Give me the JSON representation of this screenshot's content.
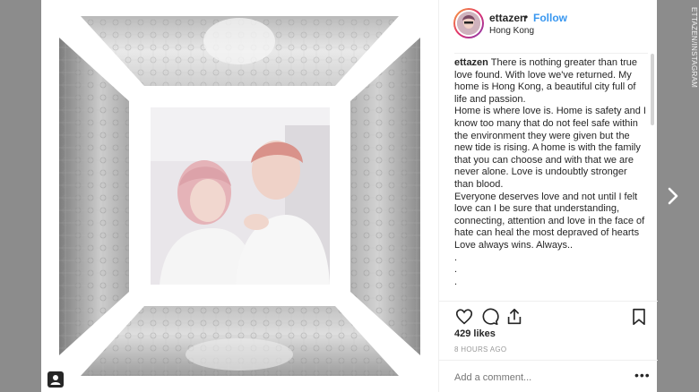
{
  "header": {
    "username": "ettazen",
    "separator": "•",
    "follow_label": "Follow",
    "location": "Hong Kong"
  },
  "caption": {
    "username": "ettazen",
    "lines": [
      "There is nothing greater than true love found. With love we've returned. My home is Hong Kong, a beautiful city full of life and passion.",
      "Home is where love is. Home is safety and I know too many that do not feel safe within the environment they were given but the new tide is rising. A home is with the family that you can choose and with that we are never alone. Love is undoubtly stronger than blood.",
      "Everyone deserves love and not until I felt love can I be sure that understanding, connecting, attention and love in the face of hate can heal the most depraved of hearts",
      "Love always wins. Always..",
      ".",
      ".",
      "."
    ]
  },
  "actions": {
    "like_icon": "heart-icon",
    "comment_icon": "comment-icon",
    "share_icon": "share-icon",
    "save_icon": "bookmark-icon"
  },
  "likes": "429 likes",
  "timestamp": "8 HOURS AGO",
  "comment": {
    "placeholder": "Add a comment...",
    "more": "•••"
  },
  "watermark": "ETTAZEN/INSTAGRAM",
  "colors": {
    "follow": "#3897f0",
    "text": "#262626",
    "muted": "#999999",
    "backdrop": "#8c8c8c"
  }
}
